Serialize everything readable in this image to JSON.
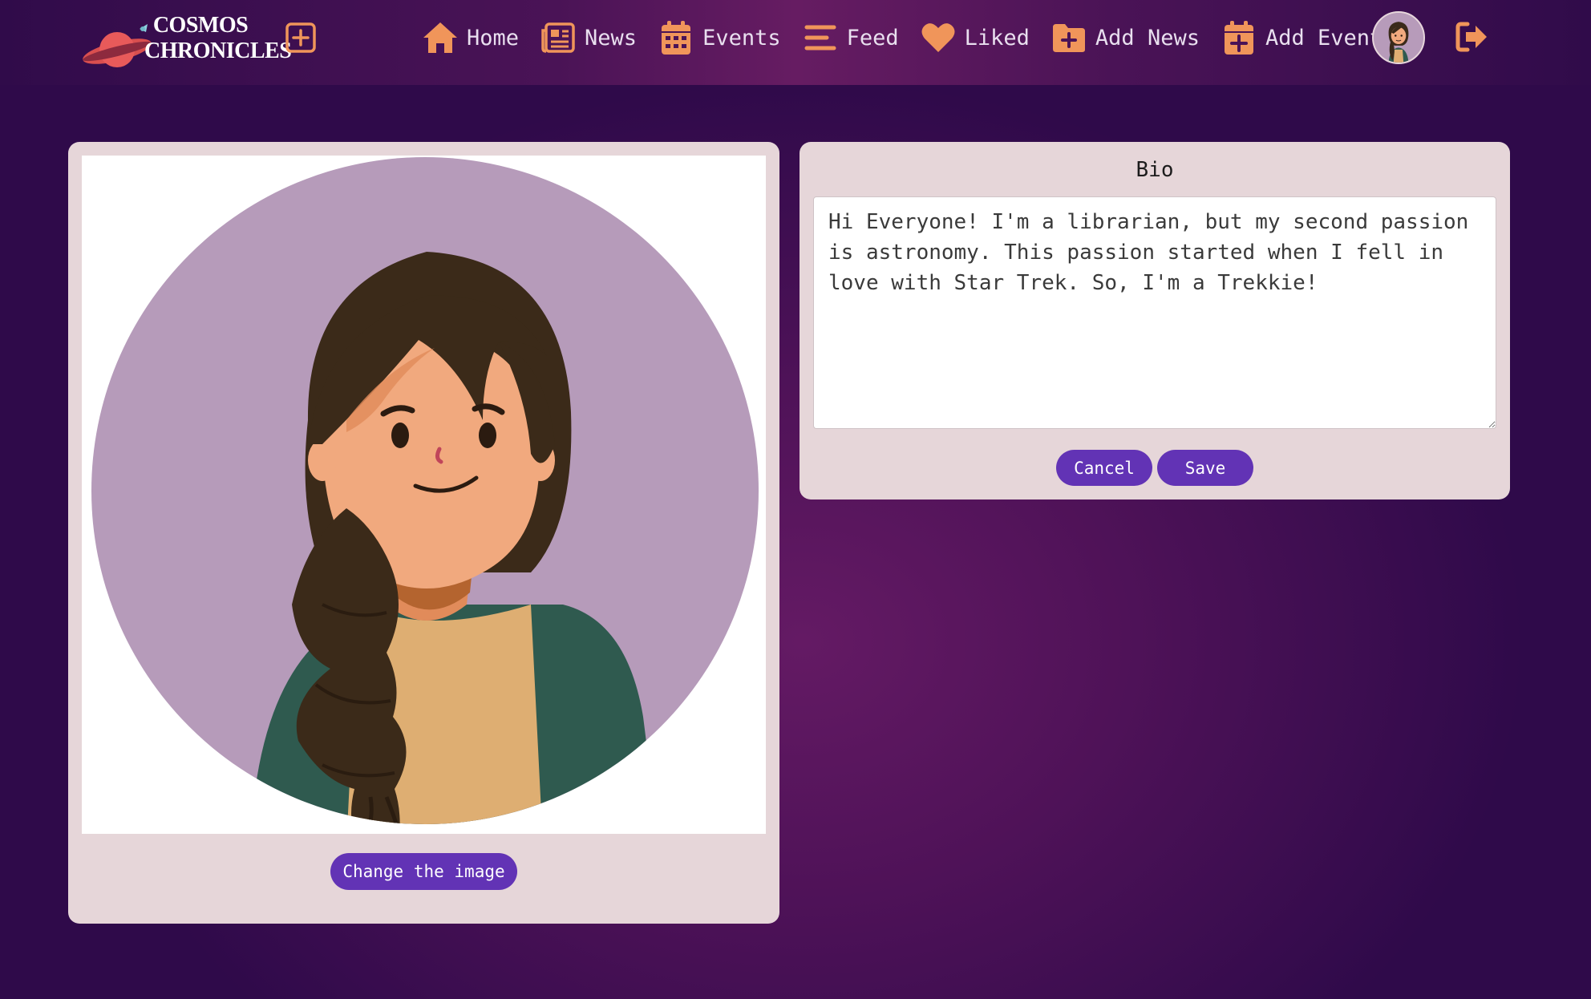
{
  "app": {
    "logo_line1": "COSMOS",
    "logo_line2": "CHRONICLES"
  },
  "nav": {
    "items": [
      {
        "label": "Home",
        "icon": "home-icon"
      },
      {
        "label": "News",
        "icon": "newspaper-icon"
      },
      {
        "label": "Events",
        "icon": "calendar-icon"
      },
      {
        "label": "Feed",
        "icon": "feed-lines-icon"
      },
      {
        "label": "Liked",
        "icon": "heart-icon"
      },
      {
        "label": "Add News",
        "icon": "folder-plus-icon"
      },
      {
        "label": "Add Events",
        "icon": "calendar-plus-icon"
      }
    ]
  },
  "profile": {
    "change_image_label": "Change the image"
  },
  "bio": {
    "title": "Bio",
    "text": "Hi Everyone! I'm a librarian, but my second passion is astronomy. This passion started when I fell in love with Star Trek. So, I'm a Trekkie!",
    "cancel_label": "Cancel",
    "save_label": "Save"
  },
  "colors": {
    "accent_orange": "#f0955a",
    "button_purple": "#6233b5",
    "card_bg": "#e6d6d9",
    "avatar_circle": "#b79bba"
  }
}
